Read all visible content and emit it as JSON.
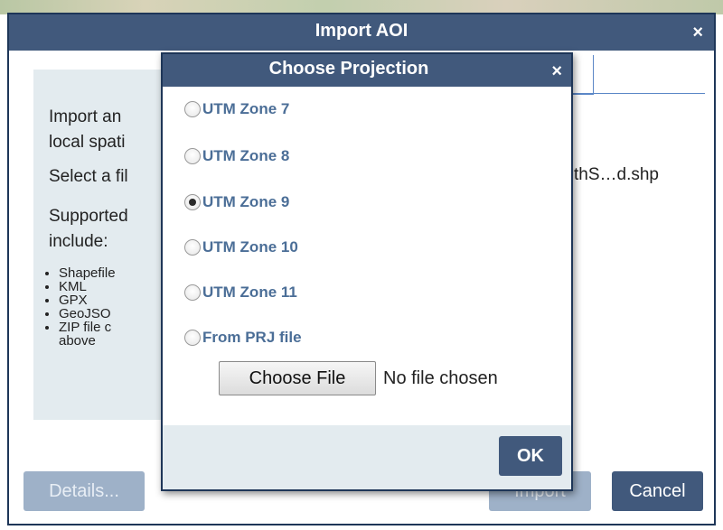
{
  "outer_dialog": {
    "title": "Import AOI",
    "close_glyph": "×",
    "intro_line1": "Import an",
    "intro_line2": "local spati",
    "select_text": "Select a fil",
    "supported_line1": "Supported",
    "supported_line2": "include:",
    "formats": [
      "Shapefile",
      "KML",
      "GPX",
      "GeoJSO",
      "ZIP file c",
      "above"
    ],
    "file_name": "thS…d.shp",
    "buttons": {
      "details": "Details...",
      "import": "Import",
      "cancel": "Cancel"
    }
  },
  "projection_dialog": {
    "title": "Choose Projection",
    "close_glyph": "×",
    "options": [
      {
        "label": "UTM Zone 7",
        "checked": false
      },
      {
        "label": "UTM Zone 8",
        "checked": false
      },
      {
        "label": "UTM Zone 9",
        "checked": true
      },
      {
        "label": "UTM Zone 10",
        "checked": false
      },
      {
        "label": "UTM Zone 11",
        "checked": false
      },
      {
        "label": "From PRJ file",
        "checked": false
      }
    ],
    "file_input": {
      "button_label": "Choose File",
      "status": "No file chosen"
    },
    "ok_label": "OK"
  },
  "colors": {
    "titlebar": "#41597c",
    "panel": "#e3ebef",
    "radio_label": "#4b6e97",
    "disabled_button": "#9eb1c8"
  },
  "icons": {
    "close": "close-icon",
    "radio": "radio-button"
  }
}
